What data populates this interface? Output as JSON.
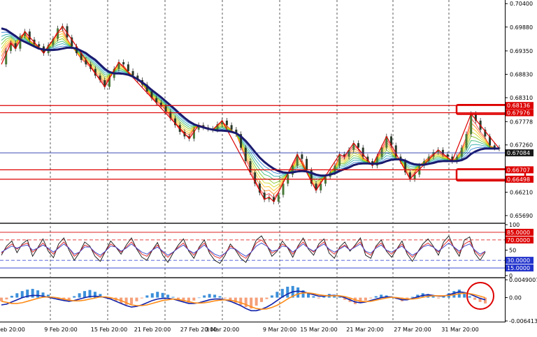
{
  "chart_data": [
    {
      "type": "line",
      "panel": "price",
      "y_ticks": [
        "0.70400",
        "0.69880",
        "0.69350",
        "0.68830",
        "0.68310",
        "0.67778",
        "0.67260",
        "0.66730",
        "0.66210",
        "0.65690"
      ],
      "ylim": [
        0.6555,
        0.7045
      ],
      "x_ticks": [
        "eb 20:00",
        "9 Feb 20:00",
        "15 Feb 20:00",
        "21 Feb 20:00",
        "27 Feb 20:00",
        "3 Mar 20:00",
        "9 Mar 20:00",
        "15 Mar 20:00",
        "21 Mar 20:00",
        "27 Mar 20:00",
        "31 Mar 20:00"
      ],
      "price_series": [
        0.6905,
        0.6935,
        0.6952,
        0.694,
        0.6968,
        0.6978,
        0.696,
        0.695,
        0.6945,
        0.693,
        0.6948,
        0.6962,
        0.6985,
        0.699,
        0.6965,
        0.6945,
        0.693,
        0.6915,
        0.6905,
        0.6895,
        0.688,
        0.687,
        0.6855,
        0.6875,
        0.6895,
        0.691,
        0.6905,
        0.689,
        0.688,
        0.687,
        0.686,
        0.6845,
        0.683,
        0.682,
        0.6812,
        0.68,
        0.6785,
        0.677,
        0.6755,
        0.6745,
        0.674,
        0.676,
        0.677,
        0.6765,
        0.6762,
        0.676,
        0.6772,
        0.678,
        0.677,
        0.676,
        0.675,
        0.672,
        0.669,
        0.6665,
        0.664,
        0.662,
        0.6605,
        0.661,
        0.66,
        0.6615,
        0.664,
        0.666,
        0.668,
        0.6705,
        0.6695,
        0.667,
        0.664,
        0.6625,
        0.664,
        0.6655,
        0.6665,
        0.668,
        0.6705,
        0.67,
        0.6715,
        0.673,
        0.672,
        0.67,
        0.669,
        0.668,
        0.67,
        0.672,
        0.6745,
        0.6725,
        0.67,
        0.669,
        0.6665,
        0.665,
        0.666,
        0.668,
        0.669,
        0.67,
        0.671,
        0.6715,
        0.6705,
        0.67,
        0.669,
        0.67,
        0.672,
        0.675,
        0.6795,
        0.678,
        0.676,
        0.6745,
        0.6725,
        0.672,
        0.6718
      ],
      "ma_series": [
        {
          "name": "",
          "color": "#1a1a6e",
          "values": [
            0.6985,
            0.6982,
            0.6975,
            0.6968,
            0.696,
            0.6955,
            0.695,
            0.6945,
            0.694,
            0.6938,
            0.6937,
            0.6937,
            0.6938,
            0.694,
            0.6942,
            0.6942,
            0.694,
            0.6935,
            0.693,
            0.6922,
            0.6915,
            0.6905,
            0.6895,
            0.6888,
            0.6885,
            0.6885,
            0.6884,
            0.6882,
            0.6878,
            0.6872,
            0.6865,
            0.6857,
            0.6848,
            0.684,
            0.6832,
            0.6823,
            0.6814,
            0.6805,
            0.6795,
            0.6786,
            0.6778,
            0.6772,
            0.6768,
            0.6765,
            0.6762,
            0.676,
            0.6758,
            0.6758,
            0.6757,
            0.6755,
            0.6752,
            0.6745,
            0.6735,
            0.6723,
            0.671,
            0.6698,
            0.6688,
            0.668,
            0.6673,
            0.6668,
            0.6665,
            0.6664,
            0.6665,
            0.6667,
            0.6668,
            0.6667,
            0.6664,
            0.666,
            0.6658,
            0.6658,
            0.666,
            0.6663,
            0.6668,
            0.6672,
            0.6676,
            0.6681,
            0.6684,
            0.6685,
            0.6685,
            0.6684,
            0.6684,
            0.6686,
            0.669,
            0.6693,
            0.6694,
            0.6694,
            0.6691,
            0.6686,
            0.6683,
            0.6682,
            0.6682,
            0.6684,
            0.6686,
            0.6689,
            0.669,
            0.669,
            0.669,
            0.669,
            0.6692,
            0.6697,
            0.6706,
            0.6712,
            0.6716,
            0.6718,
            0.6718,
            0.6718,
            0.6718
          ]
        }
      ],
      "horizontal_levels": [
        {
          "value": 0.68136,
          "label": "0.68136",
          "color": "#dd0000"
        },
        {
          "value": 0.67976,
          "label": "0.67976",
          "color": "#dd0000"
        },
        {
          "value": 0.66707,
          "label": "0.66707",
          "color": "#dd0000"
        },
        {
          "value": 0.66498,
          "label": "0.66498",
          "color": "#dd0000"
        }
      ],
      "current_price": {
        "value": 0.67084,
        "label": "0.67084",
        "color": "#2233aa"
      }
    },
    {
      "type": "line",
      "panel": "oscillator",
      "y_ticks": [
        "100",
        "50",
        "0"
      ],
      "ylim": [
        0,
        100
      ],
      "levels": [
        {
          "value": 85,
          "label": "85.0000",
          "color": "#dd0000"
        },
        {
          "value": 70,
          "label": "70.0000",
          "color": "#dd0000"
        },
        {
          "value": 30,
          "label": "30.0000",
          "color": "#2233cc"
        },
        {
          "value": 15,
          "label": "15.0000",
          "color": "#2233cc"
        }
      ],
      "series": [
        {
          "name": "",
          "color": "#111111",
          "values": [
            40,
            58,
            68,
            45,
            62,
            70,
            38,
            55,
            72,
            48,
            35,
            62,
            74,
            50,
            30,
            45,
            66,
            58,
            38,
            28,
            48,
            68,
            56,
            42,
            60,
            74,
            52,
            36,
            30,
            50,
            65,
            40,
            26,
            44,
            60,
            72,
            48,
            34,
            56,
            70,
            44,
            30,
            24,
            40,
            62,
            50,
            34,
            26,
            46,
            70,
            78,
            60,
            38,
            48,
            68,
            55,
            36,
            58,
            74,
            52,
            40,
            62,
            72,
            44,
            34,
            56,
            66,
            48,
            60,
            74,
            40,
            34,
            58,
            70,
            48,
            36,
            52,
            68,
            42,
            28,
            46,
            62,
            72,
            58,
            40,
            66,
            78,
            54,
            38,
            70,
            76,
            44,
            30,
            46
          ]
        },
        {
          "name": "",
          "color": "#dd2222",
          "values": [
            44,
            54,
            62,
            52,
            60,
            64,
            46,
            54,
            64,
            52,
            42,
            56,
            66,
            54,
            38,
            46,
            60,
            56,
            44,
            36,
            48,
            62,
            56,
            46,
            56,
            66,
            54,
            42,
            38,
            50,
            60,
            46,
            36,
            46,
            56,
            64,
            50,
            40,
            54,
            64,
            48,
            38,
            34,
            44,
            58,
            52,
            40,
            34,
            46,
            64,
            70,
            60,
            44,
            50,
            62,
            56,
            42,
            56,
            66,
            54,
            46,
            58,
            66,
            50,
            42,
            54,
            60,
            50,
            58,
            66,
            46,
            40,
            56,
            64,
            50,
            42,
            52,
            62,
            46,
            36,
            46,
            58,
            64,
            56,
            46,
            60,
            70,
            56,
            44,
            62,
            68,
            48,
            38,
            48
          ]
        },
        {
          "name": "",
          "color": "#3344cc",
          "values": [
            46,
            52,
            58,
            54,
            58,
            60,
            50,
            54,
            60,
            54,
            46,
            54,
            62,
            54,
            42,
            46,
            56,
            56,
            46,
            40,
            48,
            58,
            56,
            48,
            54,
            62,
            54,
            46,
            42,
            50,
            56,
            48,
            40,
            46,
            54,
            60,
            50,
            44,
            52,
            60,
            50,
            42,
            38,
            44,
            54,
            52,
            44,
            38,
            46,
            58,
            64,
            58,
            48,
            50,
            58,
            56,
            46,
            54,
            62,
            54,
            48,
            56,
            62,
            52,
            46,
            52,
            58,
            50,
            56,
            62,
            48,
            44,
            54,
            60,
            50,
            46,
            52,
            58,
            48,
            40,
            46,
            56,
            60,
            56,
            48,
            56,
            64,
            56,
            48,
            58,
            62,
            50,
            42,
            48
          ]
        }
      ]
    },
    {
      "type": "bar",
      "panel": "macd",
      "y_ticks": [
        "0.0049007",
        "0.00",
        "-0.0064137"
      ],
      "ylim": [
        -0.0064137,
        0.0049007
      ],
      "histogram": [
        -0.001,
        -0.0005,
        0.0005,
        0.0012,
        0.0018,
        0.0022,
        0.0024,
        0.002,
        0.0014,
        0.0008,
        0.0002,
        -0.0004,
        -0.0008,
        -0.0006,
        0.0004,
        0.0012,
        0.0018,
        0.0021,
        0.0016,
        0.001,
        0.0003,
        -0.0004,
        -0.001,
        -0.0016,
        -0.002,
        -0.0018,
        -0.001,
        -0.0002,
        0.0006,
        0.0012,
        0.0016,
        0.0013,
        0.0008,
        0.0002,
        -0.0004,
        -0.001,
        -0.0014,
        -0.0008,
        0.0,
        0.0006,
        0.001,
        0.0008,
        0.0004,
        -0.0002,
        -0.0008,
        -0.0014,
        -0.002,
        -0.0026,
        -0.003,
        -0.0022,
        -0.0012,
        -0.0004,
        0.0006,
        0.0016,
        0.0024,
        0.003,
        0.0032,
        0.0028,
        0.002,
        0.0012,
        0.0004,
        -0.0002,
        0.0004,
        0.001,
        0.0008,
        0.0002,
        -0.0006,
        -0.0012,
        -0.0018,
        -0.0014,
        -0.0008,
        -0.0002,
        0.0004,
        0.0008,
        0.0006,
        0.0002,
        -0.0004,
        -0.001,
        -0.0006,
        0.0002,
        0.0008,
        0.0012,
        0.001,
        0.0004,
        -0.0002,
        0.0004,
        0.0012,
        0.0018,
        0.0022,
        0.0014,
        0.0004,
        -0.0006,
        -0.0012,
        -0.0016
      ],
      "series": [
        {
          "name": "",
          "color": "#1122aa",
          "values": [
            -0.002,
            -0.0018,
            -0.0012,
            -0.0006,
            0.0,
            0.0004,
            0.0006,
            0.0006,
            0.0004,
            0.0001,
            -0.0002,
            -0.0005,
            -0.0008,
            -0.001,
            -0.0008,
            -0.0004,
            0.0,
            0.0003,
            0.0004,
            0.0003,
            0.0,
            -0.0004,
            -0.001,
            -0.0016,
            -0.0022,
            -0.0026,
            -0.0024,
            -0.002,
            -0.0014,
            -0.0008,
            -0.0004,
            -0.0002,
            -0.0002,
            -0.0004,
            -0.0008,
            -0.0012,
            -0.0016,
            -0.0016,
            -0.0014,
            -0.001,
            -0.0006,
            -0.0004,
            -0.0004,
            -0.0006,
            -0.001,
            -0.0016,
            -0.0022,
            -0.003,
            -0.0036,
            -0.0036,
            -0.0032,
            -0.0026,
            -0.0018,
            -0.0008,
            0.0002,
            0.001,
            0.0016,
            0.0018,
            0.0016,
            0.0012,
            0.0008,
            0.0004,
            0.0004,
            0.0006,
            0.0006,
            0.0004,
            0.0,
            -0.0006,
            -0.0012,
            -0.0014,
            -0.0012,
            -0.0008,
            -0.0004,
            0.0,
            0.0002,
            0.0002,
            -0.0002,
            -0.0006,
            -0.0006,
            -0.0002,
            0.0002,
            0.0006,
            0.0008,
            0.0006,
            0.0004,
            0.0004,
            0.0008,
            0.0012,
            0.0016,
            0.0014,
            0.001,
            0.0004,
            -0.0002,
            -0.0006
          ]
        },
        {
          "name": "",
          "color": "#ff8c1a",
          "values": [
            -0.001,
            -0.0013,
            -0.0016,
            -0.0016,
            -0.0014,
            -0.001,
            -0.0006,
            -0.0002,
            0.0001,
            0.0002,
            0.0001,
            -0.0001,
            -0.0004,
            -0.0007,
            -0.0009,
            -0.0009,
            -0.0007,
            -0.0004,
            -0.0001,
            0.0002,
            0.0002,
            0.0,
            -0.0004,
            -0.0008,
            -0.0014,
            -0.002,
            -0.0022,
            -0.0022,
            -0.002,
            -0.0016,
            -0.0012,
            -0.0008,
            -0.0006,
            -0.0004,
            -0.0005,
            -0.0008,
            -0.0011,
            -0.0014,
            -0.0015,
            -0.0014,
            -0.0012,
            -0.0009,
            -0.0007,
            -0.0006,
            -0.0007,
            -0.001,
            -0.0014,
            -0.0019,
            -0.0025,
            -0.003,
            -0.0032,
            -0.0031,
            -0.0027,
            -0.0021,
            -0.0013,
            -0.0004,
            0.0004,
            0.001,
            0.0013,
            0.0013,
            0.0011,
            0.0008,
            0.0006,
            0.0005,
            0.0005,
            0.0005,
            0.0003,
            -0.0001,
            -0.0006,
            -0.001,
            -0.0011,
            -0.001,
            -0.0007,
            -0.0004,
            -0.0001,
            0.0001,
            0.0,
            -0.0002,
            -0.0004,
            -0.0004,
            -0.0002,
            0.0001,
            0.0004,
            0.0005,
            0.0005,
            0.0005,
            0.0006,
            0.0008,
            0.0011,
            0.0012,
            0.0011,
            0.0008,
            0.0004,
            0.0
          ]
        }
      ]
    }
  ]
}
